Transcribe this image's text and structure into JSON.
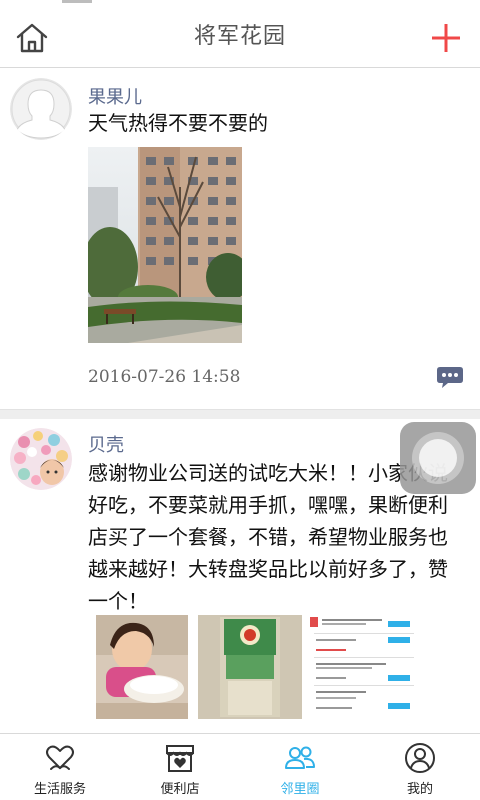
{
  "header": {
    "title": "将军花园",
    "home_icon": "home-icon",
    "add_icon": "plus-icon"
  },
  "posts": [
    {
      "username": "果果儿",
      "text": "天气热得不要不要的",
      "timestamp": "2016-07-26 14:58",
      "images": [
        "tree-courtyard-photo"
      ]
    },
    {
      "username": "贝壳",
      "text": "感谢物业公司送的试吃大米！！小家伙说好吃，不要菜就用手抓，嘿嘿，果断便利店买了一个套餐，不错，希望物业服务也越来越好！大转盘奖品比以前好多了，赞一个！",
      "images": [
        "child-eating-rice-photo",
        "rice-bag-photo",
        "order-screenshot"
      ]
    }
  ],
  "tabs": [
    {
      "label": "生活服务",
      "icon": "heart-hands-icon",
      "active": false
    },
    {
      "label": "便利店",
      "icon": "store-icon",
      "active": false
    },
    {
      "label": "邻里圈",
      "icon": "people-icon",
      "active": true
    },
    {
      "label": "我的",
      "icon": "user-icon",
      "active": false
    }
  ],
  "colors": {
    "accent": "#2fb0e8",
    "add_red": "#f04848",
    "username": "#5b6a8e"
  }
}
